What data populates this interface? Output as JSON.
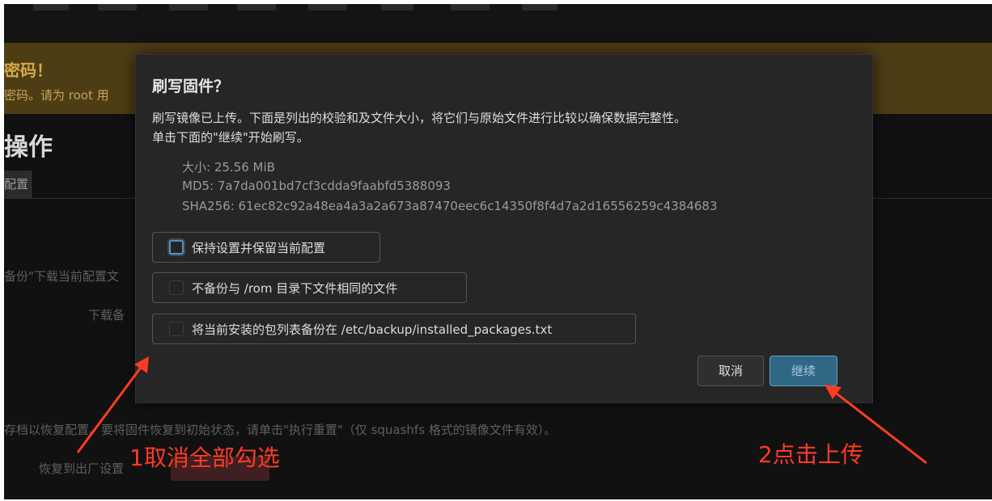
{
  "warning": {
    "title": "密码！",
    "text": "密码。请为 root 用"
  },
  "page": {
    "title": "操作",
    "tab": "配置",
    "text_backup": "备份\"下载当前配置文",
    "text_download": "下载备",
    "text_reset_desc": "存档以恢复配置。要将固件恢复到初始状态，请单击\"执行重置\"（仅 squashfs 格式的镜像文件有效）。",
    "text_reset_label": "恢复到出厂设置"
  },
  "modal": {
    "title": "刷写固件？",
    "description_line1": "刷写镜像已上传。下面是列出的校验和及文件大小，将它们与原始文件进行比较以确保数据完整性。",
    "description_line2": "单击下面的\"继续\"开始刷写。",
    "size": "大小: 25.56 MiB",
    "md5": "MD5: 7a7da001bd7cf3cdda9faabfd5388093",
    "sha256": "SHA256: 61ec82c92a48ea4a3a2a673a87470eec6c14350f8f4d7a2d16556259c4384683",
    "options": [
      {
        "label": "保持设置并保留当前配置",
        "checked": false
      },
      {
        "label": "不备份与 /rom 目录下文件相同的文件",
        "checked": false
      },
      {
        "label": "将当前安装的包列表备份在 /etc/backup/installed_packages.txt",
        "checked": false
      }
    ],
    "cancel_label": "取消",
    "continue_label": "继续"
  },
  "annotations": {
    "step1": "1取消全部勾选",
    "step2": "2点击上传",
    "color": "#ff3b24"
  }
}
